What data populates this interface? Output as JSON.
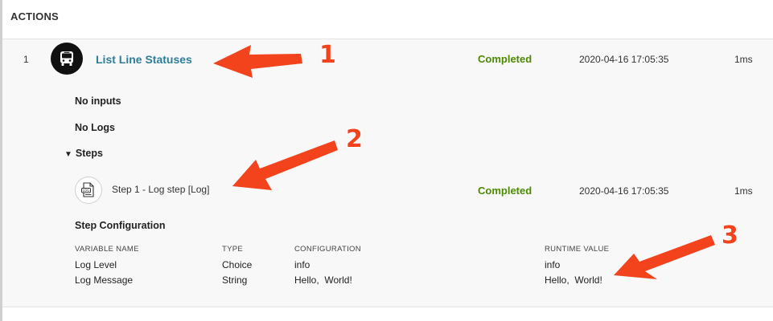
{
  "section": {
    "title": "ACTIONS"
  },
  "action": {
    "index": "1",
    "name": "List Line Statuses",
    "status": "Completed",
    "timestamp": "2020-04-16 17:05:35",
    "duration": "1ms",
    "icon": "bus-icon"
  },
  "details": {
    "inputs_label": "No inputs",
    "logs_label": "No Logs",
    "steps_label": "Steps"
  },
  "step": {
    "name": "Step 1 - Log step [Log]",
    "status": "Completed",
    "timestamp": "2020-04-16 17:05:35",
    "duration": "1ms",
    "icon": "log-file-icon"
  },
  "config": {
    "title": "Step Configuration",
    "headers": [
      "VARIABLE NAME",
      "TYPE",
      "CONFIGURATION",
      "RUNTIME VALUE"
    ],
    "rows": [
      [
        "Log Level",
        "Choice",
        "info",
        "info"
      ],
      [
        "Log Message",
        "String",
        "Hello,  World!",
        "Hello,  World!"
      ]
    ]
  },
  "callouts": [
    "1",
    "2",
    "3"
  ],
  "colors": {
    "link": "#2e7d9a",
    "success": "#4c8a00",
    "annotation": "#f2431d"
  }
}
